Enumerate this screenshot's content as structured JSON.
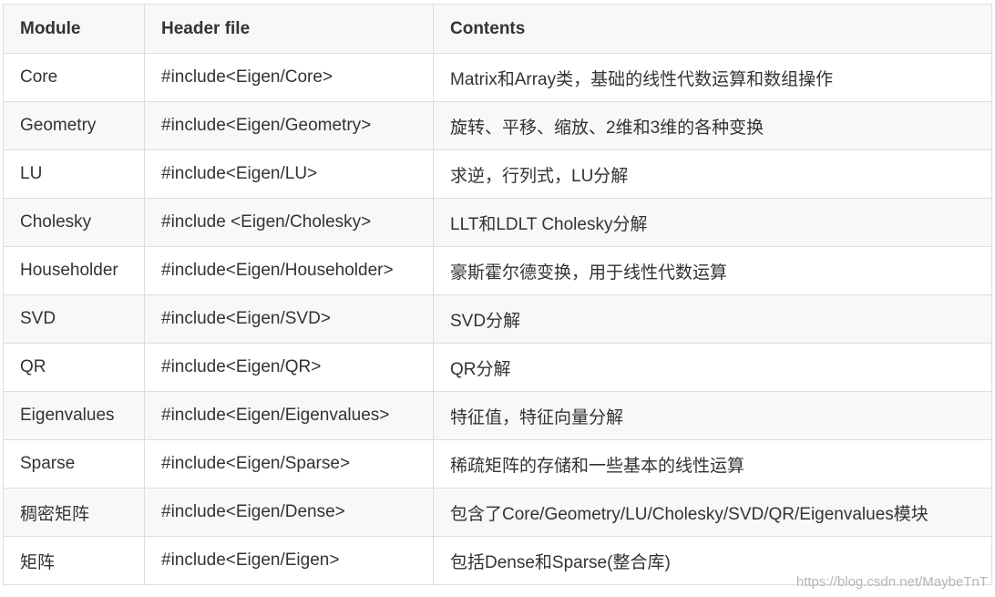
{
  "table": {
    "headers": [
      "Module",
      "Header file",
      "Contents"
    ],
    "rows": [
      [
        "Core",
        "#include<Eigen/Core>",
        "Matrix和Array类，基础的线性代数运算和数组操作"
      ],
      [
        "Geometry",
        "#include<Eigen/Geometry>",
        "旋转、平移、缩放、2维和3维的各种变换"
      ],
      [
        "LU",
        "#include<Eigen/LU>",
        "求逆，行列式，LU分解"
      ],
      [
        "Cholesky",
        "#include <Eigen/Cholesky>",
        "LLT和LDLT Cholesky分解"
      ],
      [
        "Householder",
        "#include<Eigen/Householder>",
        "豪斯霍尔德变换，用于线性代数运算"
      ],
      [
        "SVD",
        "#include<Eigen/SVD>",
        "SVD分解"
      ],
      [
        "QR",
        "#include<Eigen/QR>",
        "QR分解"
      ],
      [
        "Eigenvalues",
        "#include<Eigen/Eigenvalues>",
        "特征值，特征向量分解"
      ],
      [
        "Sparse",
        "#include<Eigen/Sparse>",
        "稀疏矩阵的存储和一些基本的线性运算"
      ],
      [
        "稠密矩阵",
        "#include<Eigen/Dense>",
        "包含了Core/Geometry/LU/Cholesky/SVD/QR/Eigenvalues模块"
      ],
      [
        "矩阵",
        "#include<Eigen/Eigen>",
        "包括Dense和Sparse(整合库)"
      ]
    ]
  },
  "watermark": "https://blog.csdn.net/MaybeTnT"
}
